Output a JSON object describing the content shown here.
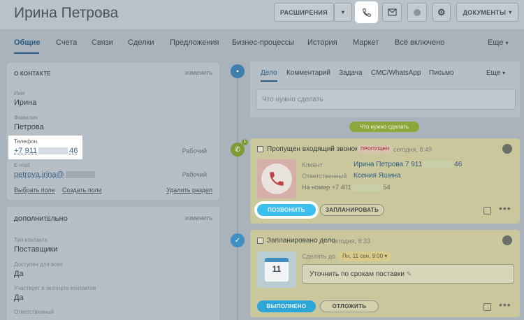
{
  "header": {
    "title": "Ирина Петрова",
    "expand_label": "РАСШИРЕНИЯ",
    "documents_label": "ДОКУМЕНТЫ",
    "icons": [
      "edit-icon",
      "chevron-down-icon",
      "phone-icon",
      "mail-icon",
      "globe-icon",
      "gear-icon"
    ]
  },
  "tabs": [
    "Общие",
    "Счета",
    "Связи",
    "Сделки",
    "Предложения",
    "Бизнес-процессы",
    "История",
    "Маркет",
    "Всё включено"
  ],
  "tabs_more": "Еще",
  "about": {
    "heading": "О КОНТАКТЕ",
    "change": "изменить",
    "name_label": "Имя",
    "name": "Ирина",
    "surname_label": "Фамилия",
    "surname": "Петрова",
    "phone_label": "Телефон",
    "phone_start": "+7 911",
    "phone_end": "46",
    "phone_type": "Рабочий",
    "email_label": "E-mail",
    "email": "petrova.irina@",
    "email_type": "Рабочий",
    "select_field": "Выбрать поле",
    "create_field": "Создать поле",
    "delete_section": "Удалить раздел"
  },
  "extra": {
    "heading": "ДОПОЛНИТЕЛЬНО",
    "change": "изменить",
    "type_label": "Тип контакта",
    "type_value": "Поставщики",
    "available_label": "Доступен для всех",
    "available_value": "Да",
    "export_label": "Участвует в экспорте контактов",
    "export_value": "Да",
    "responsible_label": "Ответственный"
  },
  "activity_tabs": [
    "Дело",
    "Комментарий",
    "Задача",
    "СМС/WhatsApp",
    "Письмо"
  ],
  "activity_more": "Еще",
  "todo_placeholder": "Что нужно сделать",
  "todo_pill": "Что нужно сделать",
  "missed_call": {
    "title": "Пропущен входящий звонок",
    "badge": "ПРОПУЩЕН",
    "date": "сегодня, 8:49",
    "client_label": "Клиент",
    "client_value_start": "Ирина Петрова 7 911",
    "client_value_end": "46",
    "responsible_label": "Ответственный",
    "responsible_value": "Ксения Яшина",
    "number_label": "На номер",
    "number_start": "+7 401",
    "number_end": "54",
    "call_button": "ПОЗВОНИТЬ",
    "plan_button": "ЗАПЛАНИРОВАТЬ",
    "counter": "1"
  },
  "planned": {
    "title": "Запланировано дело",
    "date": "сегодня, 8:33",
    "do_label": "Сделать до",
    "do_date": "Пн, 11 сен, 9:00",
    "cal_day": "11",
    "text": "Уточнить по срокам поставки",
    "done_button": "ВЫПОЛНЕНО",
    "postpone_button": "ОТЛОЖИТЬ"
  }
}
